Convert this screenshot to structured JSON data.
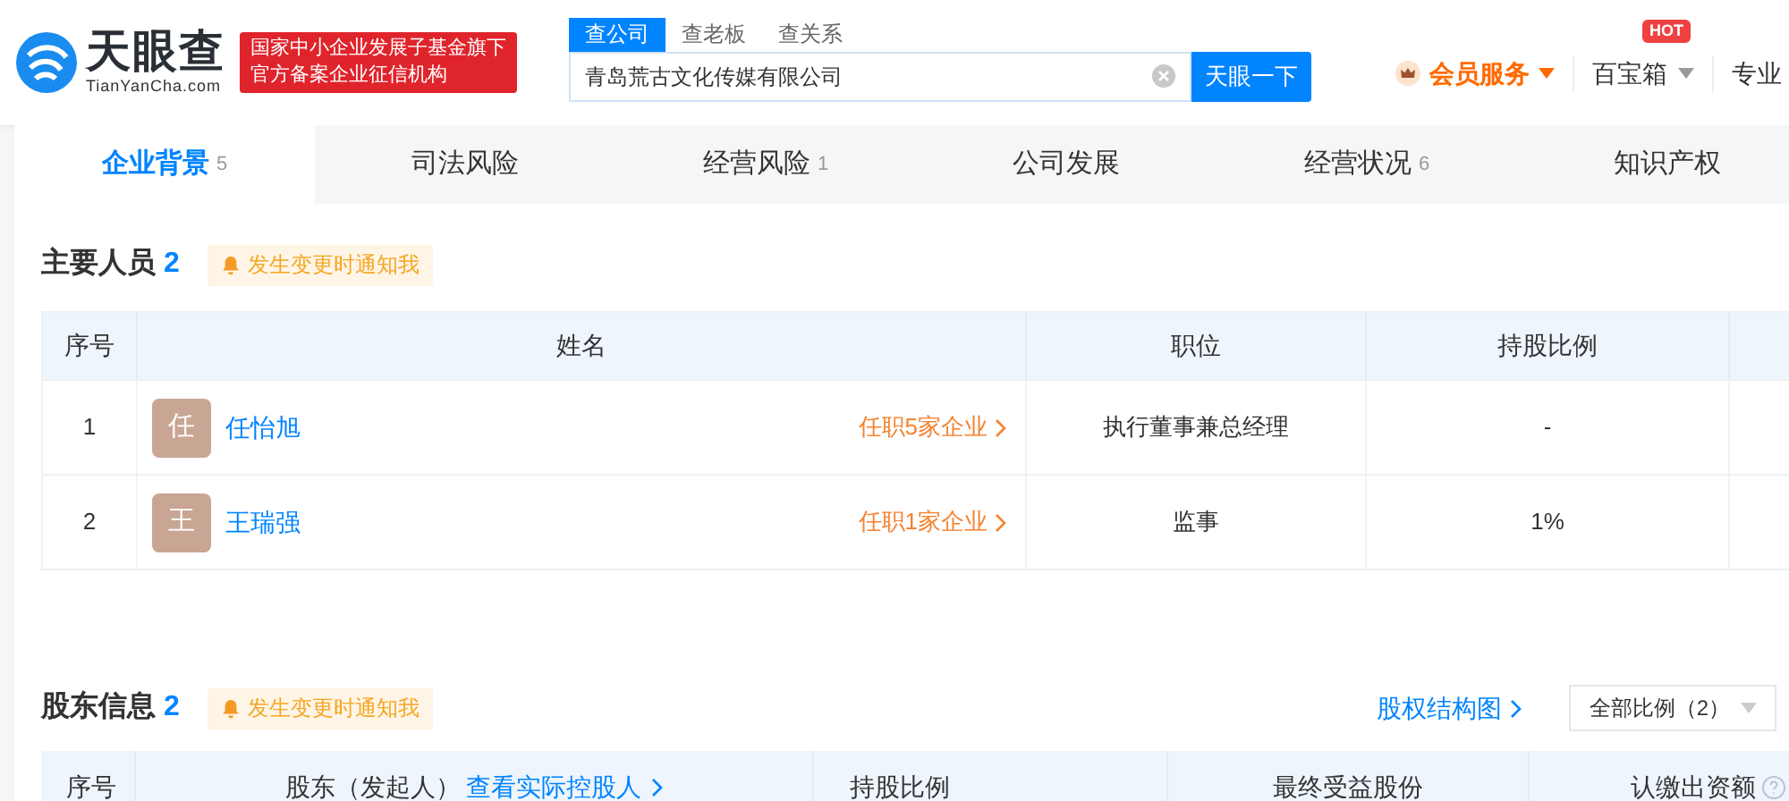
{
  "header": {
    "logo_text": "天眼查",
    "logo_domain": "TianYanCha.com",
    "badge_lines": [
      "国家中小企业发展子基金旗下",
      "官方备案企业征信机构"
    ],
    "search_tabs": [
      {
        "label": "查公司",
        "selected": true
      },
      {
        "label": "查老板",
        "selected": false
      },
      {
        "label": "查关系",
        "selected": false
      }
    ],
    "search_value": "青岛荒古文化传媒有限公司",
    "search_button": "天眼一下",
    "nav": [
      {
        "kind": "vip",
        "label": "会员服务"
      },
      {
        "kind": "menu",
        "label": "百宝箱",
        "badge": "HOT"
      },
      {
        "kind": "plain",
        "label": "专业"
      }
    ]
  },
  "tabs": [
    {
      "label": "企业背景",
      "count": "5",
      "selected": true
    },
    {
      "label": "司法风险",
      "selected": false
    },
    {
      "label": "经营风险",
      "count": "1",
      "selected": false
    },
    {
      "label": "公司发展",
      "selected": false
    },
    {
      "label": "经营状况",
      "count": "6",
      "selected": false
    },
    {
      "label": "知识产权",
      "selected": false
    }
  ],
  "staff": {
    "title": "主要人员",
    "count": "2",
    "notify": "发生变更时通知我",
    "columns": [
      "序号",
      "姓名",
      "职位",
      "持股比例"
    ],
    "rows": [
      {
        "index": "1",
        "avatar": "任",
        "name": "任怡旭",
        "link": "任职5家企业",
        "position": "执行董事兼总经理",
        "share": "-"
      },
      {
        "index": "2",
        "avatar": "王",
        "name": "王瑞强",
        "link": "任职1家企业",
        "position": "监事",
        "share": "1%"
      }
    ]
  },
  "shareholders": {
    "title": "股东信息",
    "count": "2",
    "notify": "发生变更时通知我",
    "chart_link": "股权结构图",
    "filter": "全部比例（2）",
    "columns": [
      {
        "label": "序号"
      },
      {
        "label": "股东（发起人）",
        "link": "查看实际控股人"
      },
      {
        "label": "持股比例"
      },
      {
        "label": "最终受益股份"
      },
      {
        "label": "认缴出资额",
        "help": true
      }
    ]
  }
}
